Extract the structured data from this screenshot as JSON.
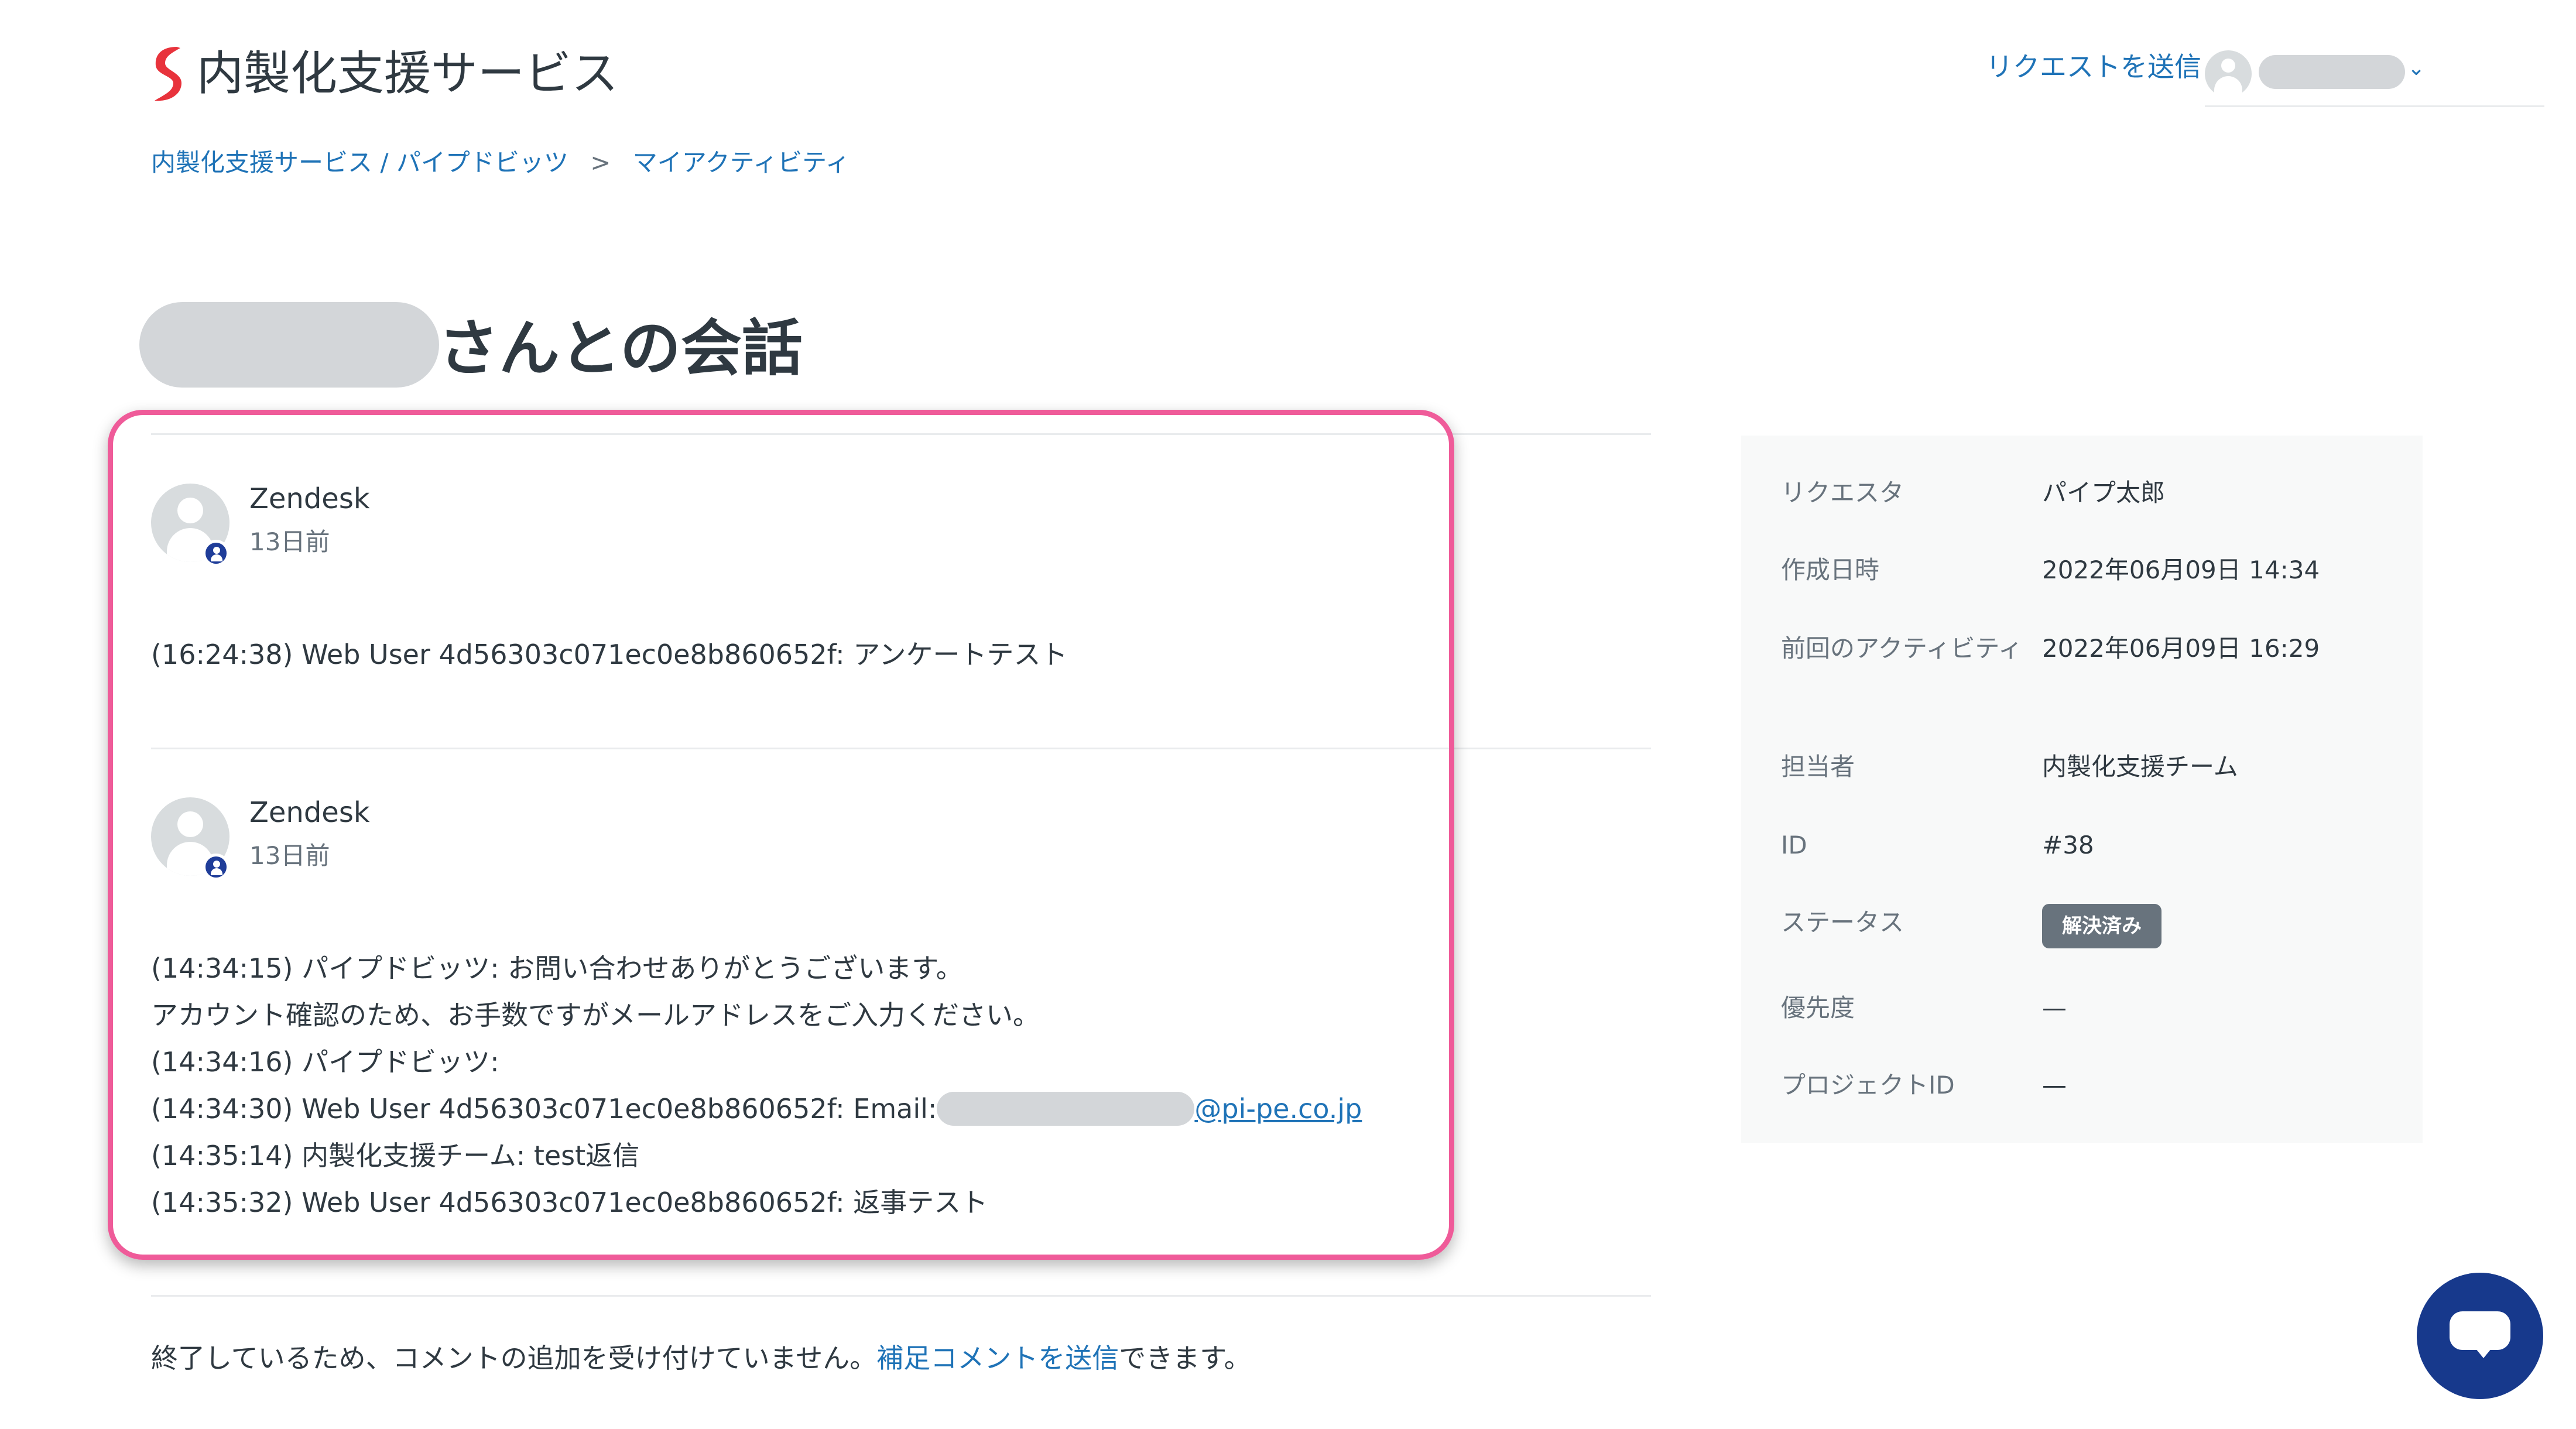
{
  "header": {
    "brand_name": "内製化支援サービス",
    "brand_color": "#e8333c",
    "request_link": "リクエストを送信",
    "user_chevron": "⌄"
  },
  "breadcrumb": {
    "items": [
      "内製化支援サービス / パイプドビッツ",
      "マイアクティビティ"
    ],
    "separator": ">"
  },
  "page": {
    "title_suffix": "さんとの会話"
  },
  "comments": [
    {
      "author": "Zendesk",
      "time": "13日前",
      "lines": [
        "(16:24:38) Web User 4d56303c071ec0e8b860652f: アンケートテスト"
      ]
    },
    {
      "author": "Zendesk",
      "time": "13日前",
      "lines": [
        "(14:34:15) パイプドビッツ: お問い合わせありがとうございます。",
        "アカウント確認のため、お手数ですがメールアドレスをご入力ください。",
        "(14:34:16) パイプドビッツ:",
        "(14:34:30) Web User 4d56303c071ec0e8b860652f: Email:",
        "(14:35:14) 内製化支援チーム: test返信",
        "(14:35:32) Web User 4d56303c071ec0e8b860652f: 返事テスト"
      ],
      "email_domain": "@pi-pe.co.jp"
    }
  ],
  "footer": {
    "text_before": "終了しているため、コメントの追加を受け付けていません。",
    "link": "補足コメントを送信",
    "text_after": "できます。"
  },
  "sidebar": {
    "requester": {
      "label": "リクエスタ",
      "value": "パイプ太郎"
    },
    "created": {
      "label": "作成日時",
      "value": "2022年06月09日 14:34"
    },
    "last_activity": {
      "label": "前回のアクティビティ",
      "value": "2022年06月09日 16:29"
    },
    "assignee": {
      "label": "担当者",
      "value": "内製化支援チーム"
    },
    "id": {
      "label": "ID",
      "value": "#38"
    },
    "status": {
      "label": "ステータス",
      "value": "解決済み"
    },
    "priority": {
      "label": "優先度",
      "value": "—"
    },
    "project_id": {
      "label": "プロジェクトID",
      "value": "—"
    }
  },
  "colors": {
    "link": "#1f73b7",
    "highlight_border": "#ef5b99",
    "chat_button": "#17398c",
    "status_badge": "#68737d"
  },
  "icons": {
    "logo": "brand-s-logo-icon",
    "chat": "chat-bubble-icon",
    "avatar": "user-avatar-icon"
  }
}
